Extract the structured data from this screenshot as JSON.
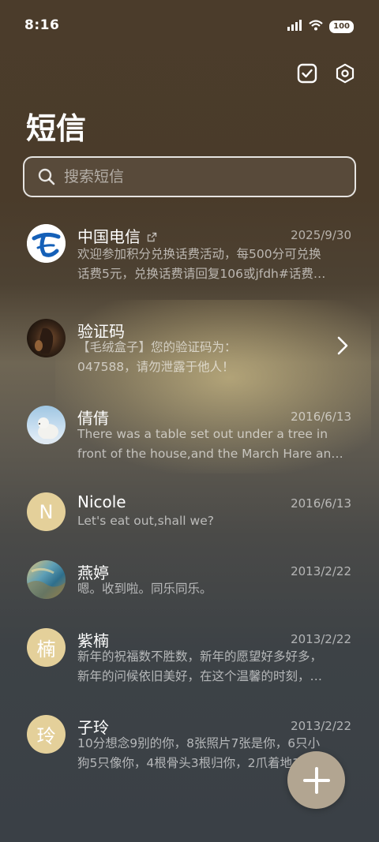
{
  "status_bar": {
    "time": "8:16",
    "battery": "100"
  },
  "header": {
    "title": "短信"
  },
  "search": {
    "placeholder": "搜索短信"
  },
  "colors": {
    "fab": "#b2a591",
    "letter_avatar": "#e4d09a",
    "telecom_blue": "#1560b8"
  },
  "conversations": [
    {
      "name": "中国电信",
      "date": "2025/9/30",
      "line1": "欢迎参加积分兑换话费活动，每500分可兑换",
      "line2": "话费5元，兑换话费请回复106或jfdh#话费…",
      "avatar": "telecom-logo-icon"
    },
    {
      "name": "验证码",
      "date": "",
      "line1": "【毛绒盒子】您的验证码为：",
      "line2": "047588，请勿泄露于他人！",
      "avatar": "photo-avatar"
    },
    {
      "name": "倩倩",
      "date": "2016/6/13",
      "line1": "There was a table set out under a tree in",
      "line2": "front of the house,and the March Hare an…",
      "avatar": "polar-bear-avatar"
    },
    {
      "name": "Nicole",
      "date": "2016/6/13",
      "line1": "Let's eat out,shall we?",
      "line2": "",
      "avatar": "N"
    },
    {
      "name": "燕婷",
      "date": "2013/2/22",
      "line1": "嗯。收到啦。同乐同乐。",
      "line2": "",
      "avatar": "landscape-avatar"
    },
    {
      "name": "紫楠",
      "date": "2013/2/22",
      "line1": "新年的祝福数不胜数，新年的愿望好多好多，",
      "line2": "新年的问候依旧美好，在这个温馨的时刻，…",
      "avatar": "楠"
    },
    {
      "name": "子玲",
      "date": "2013/2/22",
      "line1": "10分想念9别的你，8张照片7张是你，6只小",
      "line2": "狗5只像你，4根骨头3根归你，2爪着地1宗…",
      "avatar": "玲"
    }
  ]
}
